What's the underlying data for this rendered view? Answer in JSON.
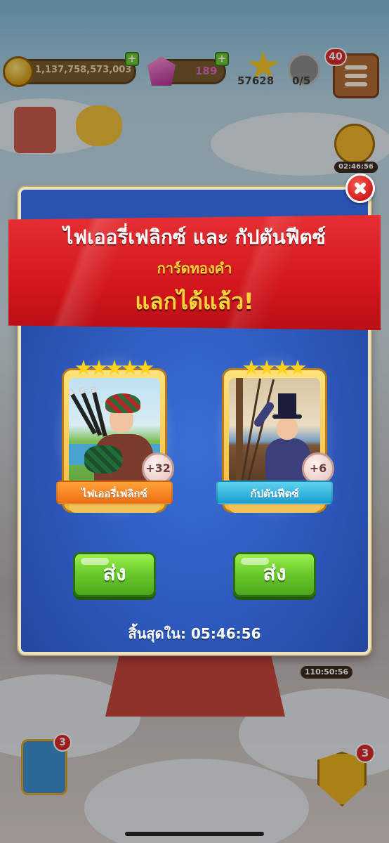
{
  "hud": {
    "coins": "1,137,758,573,003",
    "gems": "189",
    "stars": "57628",
    "shields": "0/5",
    "menu_badge": "40",
    "event_timer": "02:46:56",
    "secondary_timer": "110:50:56",
    "map_badge": "3",
    "friends_badge": "3"
  },
  "popup": {
    "title": "ไฟเออรี่เฟลิกซ์ และ กัปตันฟีตซ์",
    "subtitle": "การ์ดทองคำ",
    "headline": "แลกได้แล้ว!",
    "cards": [
      {
        "name": "ไฟเออรี่เฟลิกซ์",
        "count": "+32",
        "stars": 5,
        "send_label": "ส่ง"
      },
      {
        "name": "กัปตันฟีตซ์",
        "count": "+6",
        "stars": 4,
        "send_label": "ส่ง"
      }
    ],
    "expires": "สิ้นสุดใน: 05:46:56"
  },
  "colors": {
    "popup_bg": "#2c57b9",
    "banner_red": "#d3171d",
    "subtitle_gold": "#ffd33a",
    "send_green": "#66c72a",
    "card1_ribbon": "#ef6f15",
    "card2_ribbon": "#1b9fd0"
  },
  "icons": {
    "close": "close-icon",
    "coin": "coin-icon",
    "gem": "gem-icon",
    "star": "star-icon",
    "shield": "shield-icon",
    "menu": "menu-icon"
  }
}
